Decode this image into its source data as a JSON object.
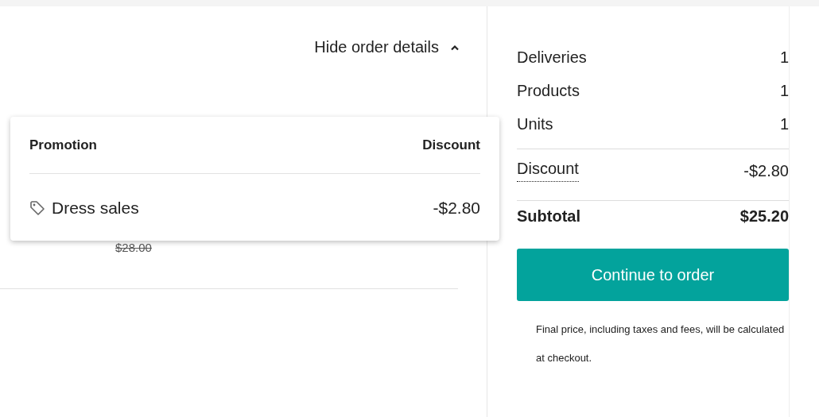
{
  "order_details_toggle": {
    "label": "Hide order details",
    "expanded": true
  },
  "order_item": {
    "original_price": "$28.00"
  },
  "promotions_popover": {
    "columns": [
      "Promotion",
      "Discount"
    ],
    "rows": [
      {
        "name": "Dress sales",
        "discount": "-$2.80"
      }
    ]
  },
  "summary": {
    "counts": [
      {
        "label": "Deliveries",
        "value": "1"
      },
      {
        "label": "Products",
        "value": "1"
      },
      {
        "label": "Units",
        "value": "1"
      }
    ],
    "discount": {
      "label": "Discount",
      "value": "-$2.80"
    },
    "subtotal": {
      "label": "Subtotal",
      "value": "$25.20"
    },
    "button": "Continue to order",
    "note": "Final price, including taxes and fees, will be calculated at checkout."
  }
}
